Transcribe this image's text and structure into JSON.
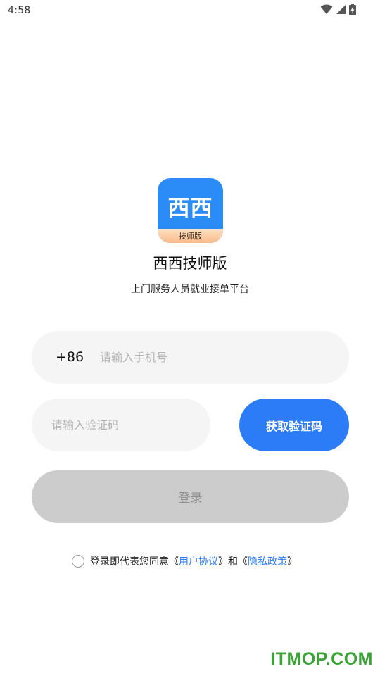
{
  "status_bar": {
    "time": "4:58",
    "icons": [
      "wifi-icon",
      "cellular-signal-icon",
      "battery-charging-icon"
    ]
  },
  "app": {
    "icon_text": "西西",
    "icon_badge": "技师版",
    "name": "西西技师版",
    "subtitle": "上门服务人员就业接单平台"
  },
  "login_form": {
    "country_code": "+86",
    "phone_placeholder": "请输入手机号",
    "phone_value": "",
    "code_placeholder": "请输入验证码",
    "code_value": "",
    "get_code_label": "获取验证码",
    "login_label": "登录"
  },
  "agreement": {
    "prefix": "登录即代表您同意《",
    "user_agreement": "用户协议",
    "middle": "》和《",
    "privacy_policy": "隐私政策",
    "suffix": "》",
    "checked": false
  },
  "watermark": "ITMOP.COM",
  "colors": {
    "accent": "#2b7cf6",
    "field_bg": "#f5f5f5",
    "disabled_button": "#cccccc",
    "watermark": "#3aa335"
  }
}
